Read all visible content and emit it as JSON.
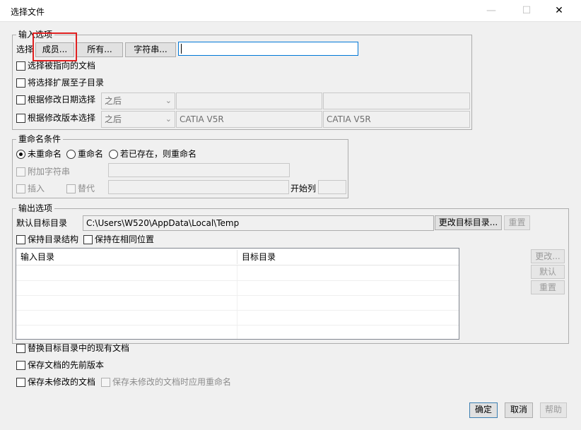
{
  "window": {
    "title": "选择文件",
    "minimize_glyph": "—",
    "maximize_glyph": "☐",
    "close_glyph": "✕"
  },
  "input_options": {
    "group_label": "输入选项",
    "select_label": "选择",
    "members_button": "成员...",
    "all_button": "所有...",
    "string_button": "字符串...",
    "string_value": "",
    "select_pointed_docs": "选择被指向的文档",
    "extend_to_subdirs": "将选择扩展至子目录",
    "by_date": {
      "label": "根据修改日期选择",
      "combo_value": "之后",
      "field1": "",
      "field2": ""
    },
    "by_version": {
      "label": "根据修改版本选择",
      "combo_value": "之后",
      "field1": "CATIA V5R",
      "field2": "CATIA V5R"
    }
  },
  "rename": {
    "group_label": "重命名条件",
    "no_rename": "未重命名",
    "rename": "重命名",
    "rename_if_exists": "若已存在，则重命名",
    "selected": "no_rename",
    "append_string": "附加字符串",
    "insert": "插入",
    "replace": "替代",
    "start_column": "开始列"
  },
  "output": {
    "group_label": "输出选项",
    "default_target_label": "默认目标目录",
    "default_target_path": "C:\\Users\\W520\\AppData\\Local\\Temp",
    "change_target_button": "更改目标目录...",
    "reset_button": "重置",
    "keep_dir_structure": "保持目录结构",
    "keep_same_location": "保持在相同位置",
    "table_columns": [
      "输入目录",
      "目标目录"
    ],
    "table_rows": [],
    "side_buttons": [
      "更改...",
      "默认",
      "重置"
    ]
  },
  "options": {
    "replace_existing": "替换目标目录中的现有文档",
    "save_previous_version": "保存文档的先前版本",
    "save_unmodified": "保存未修改的文档",
    "apply_rename_unmodified": "保存未修改的文档时应用重命名"
  },
  "footer": {
    "ok": "确定",
    "cancel": "取消",
    "help": "帮助"
  },
  "colors": {
    "highlight": "#e02020",
    "focus": "#0078d7"
  }
}
